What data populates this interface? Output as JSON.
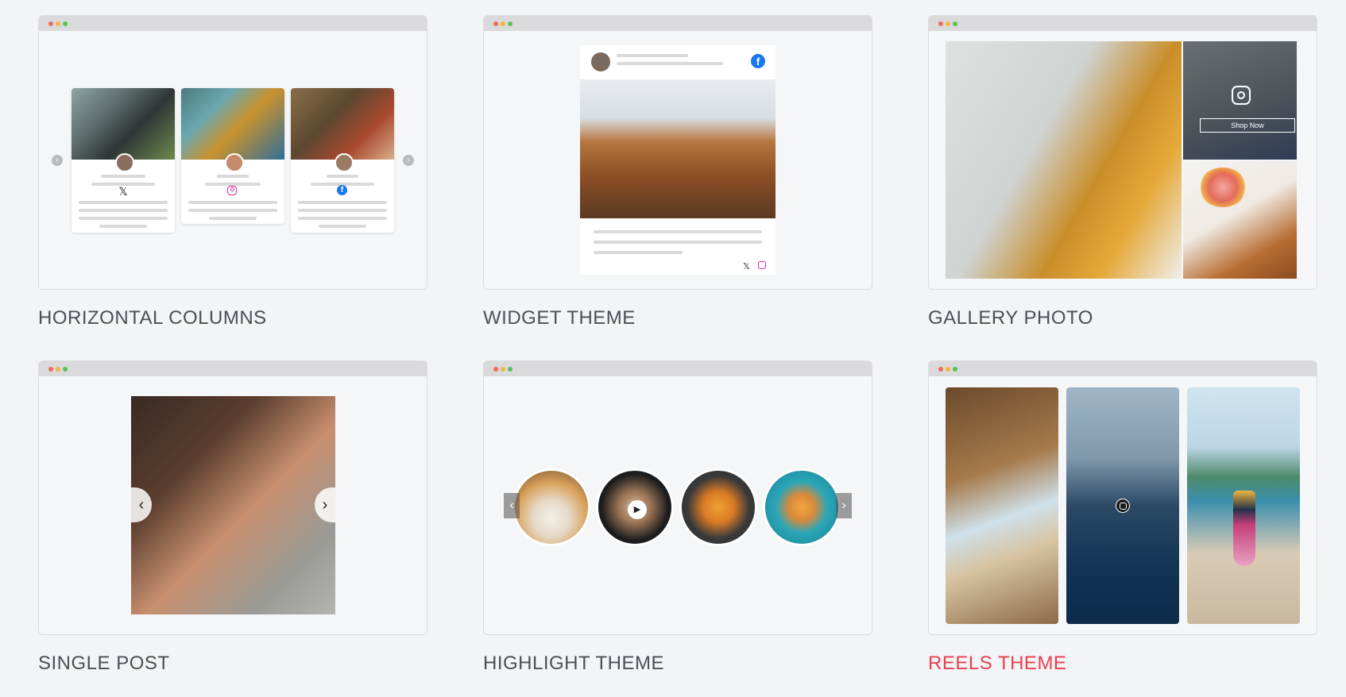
{
  "cards": [
    {
      "title": "HORIZONTAL COLUMNS",
      "active": false
    },
    {
      "title": "WIDGET THEME",
      "active": false
    },
    {
      "title": "GALLERY PHOTO",
      "active": false
    },
    {
      "title": "SINGLE POST",
      "active": false
    },
    {
      "title": "HIGHLIGHT THEME",
      "active": false
    },
    {
      "title": "REELS THEME",
      "active": true
    }
  ],
  "gallery": {
    "shop_button": "Shop Now"
  },
  "colors": {
    "accent": "#e8404f",
    "label": "#4b4f56",
    "facebook": "#1877f2",
    "instagram": "#d6249f"
  },
  "icons": [
    "x-icon",
    "instagram-icon",
    "facebook-icon",
    "play-icon",
    "chevron-left-icon",
    "chevron-right-icon"
  ]
}
